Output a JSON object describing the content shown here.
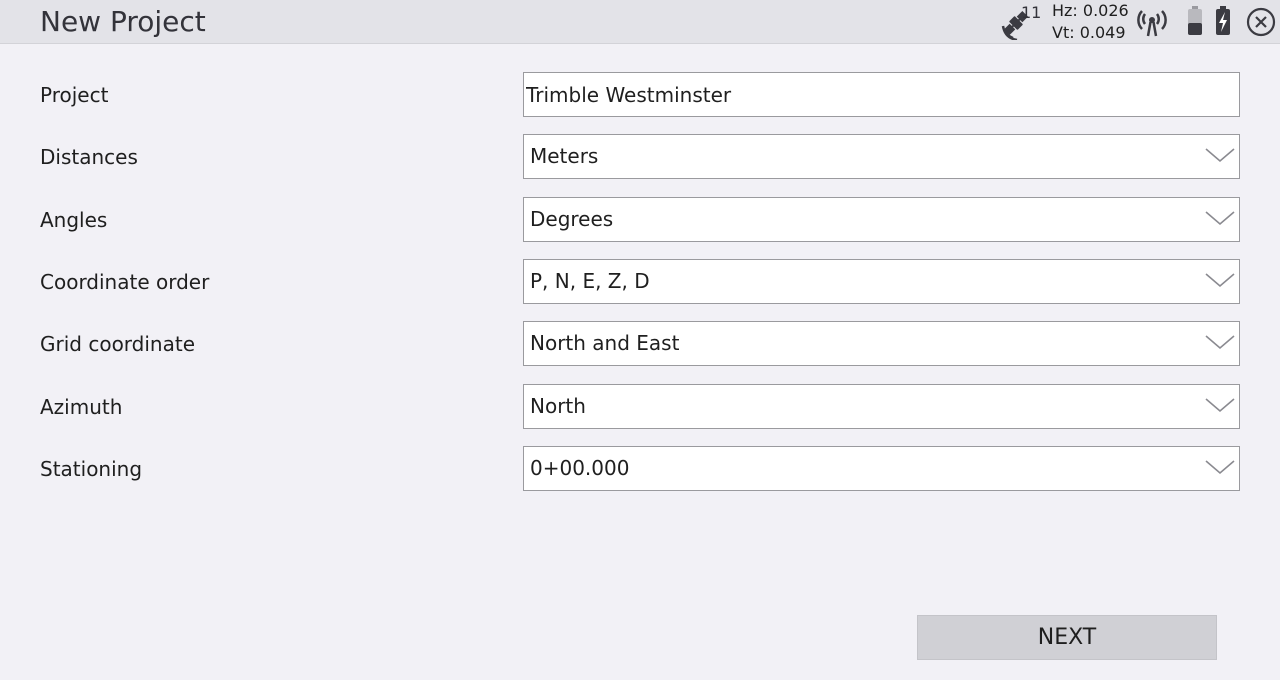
{
  "header": {
    "title": "New Project",
    "satellites": "11",
    "hz": "Hz: 0.026",
    "vt": "Vt: 0.049",
    "icons": [
      "satellite-icon",
      "radio-icon",
      "battery-icon",
      "battery-charging-icon",
      "close-icon"
    ]
  },
  "form": {
    "project": {
      "label": "Project",
      "value": "Trimble Westminster"
    },
    "distances": {
      "label": "Distances",
      "value": "Meters"
    },
    "angles": {
      "label": "Angles",
      "value": "Degrees"
    },
    "coordinate_order": {
      "label": "Coordinate order",
      "value": "P, N, E, Z, D"
    },
    "grid_coordinate": {
      "label": "Grid coordinate",
      "value": "North and East"
    },
    "azimuth": {
      "label": "Azimuth",
      "value": "North"
    },
    "stationing": {
      "label": "Stationing",
      "value": "0+00.000"
    }
  },
  "footer": {
    "next_label": "NEXT"
  }
}
